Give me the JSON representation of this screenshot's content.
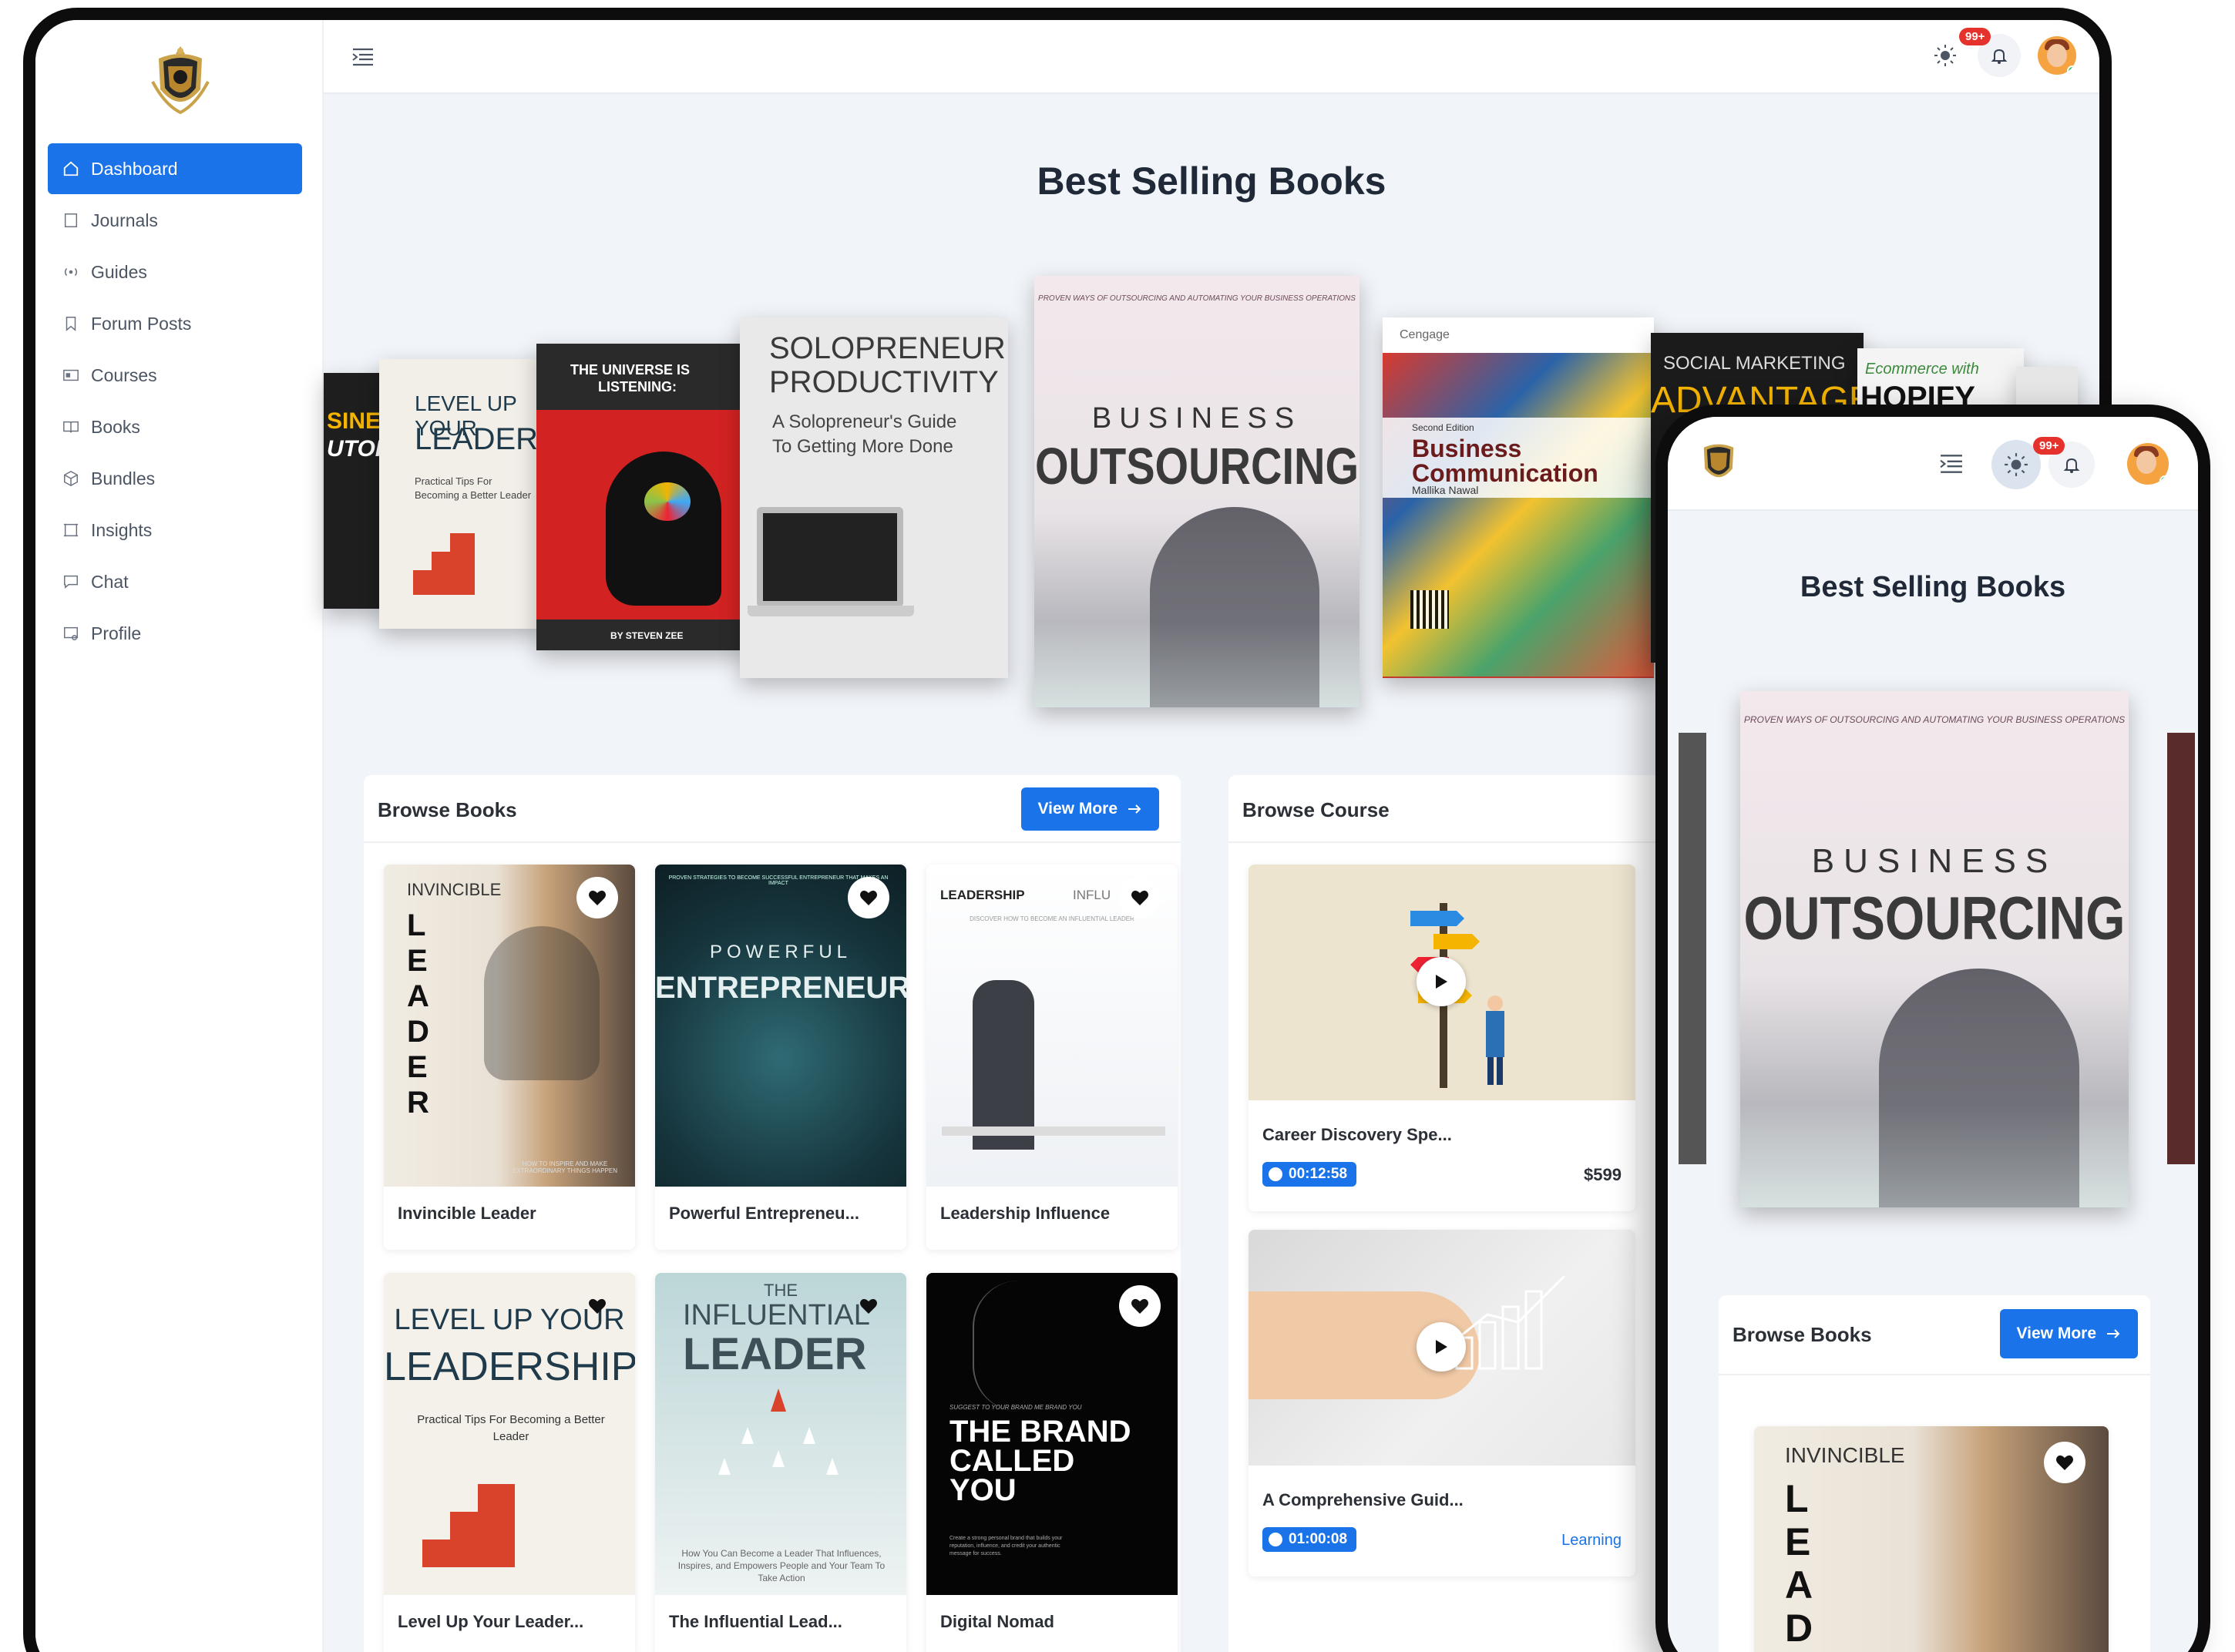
{
  "app": {
    "brand_monogram": ""
  },
  "sidebar": {
    "items": [
      {
        "label": "Dashboard",
        "icon": "home-icon",
        "active": true
      },
      {
        "label": "Journals",
        "icon": "journal-icon"
      },
      {
        "label": "Guides",
        "icon": "broadcast-icon"
      },
      {
        "label": "Forum Posts",
        "icon": "bookmark-icon"
      },
      {
        "label": "Courses",
        "icon": "id-card-icon"
      },
      {
        "label": "Books",
        "icon": "open-book-icon"
      },
      {
        "label": "Bundles",
        "icon": "box-icon"
      },
      {
        "label": "Insights",
        "icon": "frame-icon"
      },
      {
        "label": "Chat",
        "icon": "chat-icon"
      },
      {
        "label": "Profile",
        "icon": "profile-icon"
      }
    ]
  },
  "topbar": {
    "notification_badge": "99+"
  },
  "main": {
    "title": "Best Selling Books",
    "carousel": [
      {
        "line1": "SINES",
        "line2": "UTOP"
      },
      {
        "line1": "LEVEL UP YOUR",
        "line2": "LEADERSHIP",
        "sub": "Practical Tips For Becoming a Better Leader"
      },
      {
        "line1": "THE UNIVERSE IS",
        "line2": "LISTENING:",
        "author": "BY STEVEN ZEE"
      },
      {
        "line1": "SOLOPRENEUR",
        "line2": "PRODUCTIVITY",
        "sub": "A Solopreneur's Guide To Getting More Done"
      },
      {
        "top": "PROVEN WAYS OF OUTSOURCING AND AUTOMATING YOUR BUSINESS OPERATIONS",
        "line1": "BUSINESS",
        "line2": "OUTSOURCING"
      },
      {
        "publisher": "Cengage",
        "edition": "Second Edition",
        "line1": "Business",
        "line2": "Communication",
        "author": "Mallika Nawal"
      },
      {
        "line1": "SOCIAL MARKETING",
        "line2": "ADVANTAGE"
      },
      {
        "line1": "Ecommerce with",
        "line2": "HOPIFY"
      }
    ],
    "browse_books": {
      "title": "Browse Books",
      "view_more": "View More",
      "items": [
        {
          "caption": "Invincible Leader",
          "cover_top": "INVINCIBLE",
          "cover_word": "LEADER",
          "cover_note": "HOW TO INSPIRE AND MAKE EXTRAORDINARY THINGS HAPPEN"
        },
        {
          "caption": "Powerful Entrepreneu...",
          "cover_top": "PROVEN STRATEGIES TO BECOME SUCCESSFUL ENTREPRENEUR THAT MAKES AN IMPACT",
          "cover_line1": "POWERFUL",
          "cover_line2": "ENTREPRENEUR"
        },
        {
          "caption": "Leadership Influence",
          "cover_line1": "LEADERSHIP",
          "cover_line2": "INFLU",
          "cover_note": "DISCOVER HOW TO BECOME AN INFLUENTIAL LEADER"
        },
        {
          "caption": "Level Up Your Leader...",
          "cover_line1": "LEVEL UP YOUR",
          "cover_line2": "LEADERSHIP",
          "cover_note": "Practical Tips For Becoming a Better Leader"
        },
        {
          "caption": "The Influential Lead...",
          "cover_top": "THE",
          "cover_line1": "INFLUENTIAL",
          "cover_line2": "LEADER",
          "cover_note": "How You Can Become a Leader That Influences, Inspires, and Empowers People and Your Team To Take Action"
        },
        {
          "caption": "Digital Nomad",
          "cover_top": "SUGGEST TO YOUR BRAND ME BRAND YOU",
          "cover_line1": "THE BRAND",
          "cover_line2": "CALLED",
          "cover_line3": "YOU",
          "cover_note": "Create a strong personal brand that builds your reputation, influence, and credit your authentic message for success."
        }
      ]
    },
    "browse_course": {
      "title": "Browse Course",
      "items": [
        {
          "title": "Career Discovery Spe...",
          "duration": "00:12:58",
          "price": "$599"
        },
        {
          "title": "A Comprehensive Guid...",
          "duration": "01:00:08",
          "tag": "Learning"
        }
      ]
    }
  },
  "phone": {
    "badge": "99+",
    "title": "Best Selling Books",
    "book": {
      "top": "PROVEN WAYS OF OUTSOURCING AND AUTOMATING YOUR BUSINESS OPERATIONS",
      "line1": "BUSINESS",
      "line2": "OUTSOURCING"
    },
    "browse_books": {
      "title": "Browse Books",
      "view_more": "View More",
      "card_top": "INVINCIBLE",
      "card_word": "LEAD"
    }
  },
  "colors": {
    "accent": "#1a73e8",
    "badge": "#e5322d",
    "online": "#22c55e"
  }
}
